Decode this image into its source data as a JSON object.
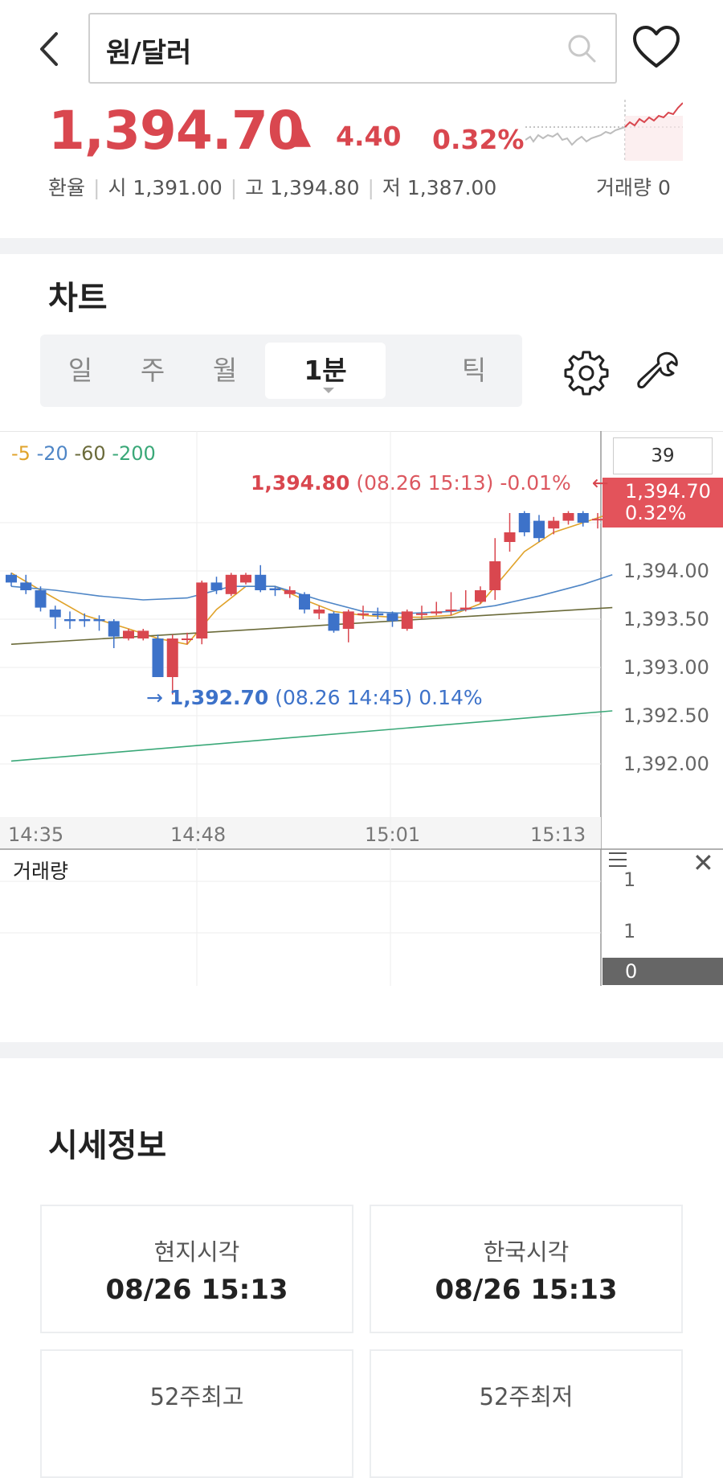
{
  "header": {
    "search_value": "원/달러",
    "price": "1,394.70",
    "arrow": "▲",
    "change": "4.40",
    "change_pct": "0.32%",
    "info": {
      "type_label": "환율",
      "open_label": "시",
      "open": "1,391.00",
      "high_label": "고",
      "high": "1,394.80",
      "low_label": "저",
      "low": "1,387.00"
    },
    "volume_label": "거래량 0"
  },
  "chart_section": {
    "title": "차트",
    "tabs": [
      {
        "label": "일",
        "active": false
      },
      {
        "label": "주",
        "active": false
      },
      {
        "label": "월",
        "active": false
      },
      {
        "label": "1분",
        "active": true
      },
      {
        "label": "틱",
        "active": false
      }
    ],
    "count_value": "39",
    "current_price_tag": "1,394.70",
    "current_pct_tag": "0.32%",
    "legend": [
      "5",
      "20",
      "60",
      "200"
    ],
    "max_annotation": {
      "price": "1,394.80",
      "detail": "(08.26 15:13) -0.01%",
      "arrow": "←"
    },
    "min_annotation": {
      "arrow": "→",
      "price": "1,392.70",
      "detail": "(08.26 14:45) 0.14%"
    },
    "volume_title": "거래량",
    "volume_ticks": [
      "1",
      "1"
    ],
    "volume_tag": "0"
  },
  "market_info": {
    "title": "시세정보",
    "cards": [
      {
        "label": "현지시각",
        "value": "08/26 15:13"
      },
      {
        "label": "한국시각",
        "value": "08/26 15:13"
      },
      {
        "label": "52주최고",
        "value": ""
      },
      {
        "label": "52주최저",
        "value": ""
      }
    ]
  },
  "colors": {
    "up": "#d9474f",
    "down": "#3d72c9",
    "ma5": "#e0a32b",
    "ma20": "#4f86c6",
    "ma60": "#6b6b3a",
    "ma200": "#3aa878"
  },
  "chart_data": {
    "type": "candlestick",
    "x_ticks": [
      "14:35",
      "14:48",
      "15:01",
      "15:13"
    ],
    "y_ticks": [
      "1,394.00",
      "1,393.50",
      "1,393.00",
      "1,392.50",
      "1,392.00"
    ],
    "ylim": [
      1391.7,
      1395.2
    ],
    "candles": [
      {
        "o": 1393.96,
        "c": 1393.88,
        "h": 1393.98,
        "l": 1393.84
      },
      {
        "o": 1393.88,
        "c": 1393.8,
        "h": 1393.96,
        "l": 1393.76
      },
      {
        "o": 1393.8,
        "c": 1393.62,
        "h": 1393.84,
        "l": 1393.58
      },
      {
        "o": 1393.6,
        "c": 1393.52,
        "h": 1393.64,
        "l": 1393.4
      },
      {
        "o": 1393.5,
        "c": 1393.48,
        "h": 1393.58,
        "l": 1393.4
      },
      {
        "o": 1393.5,
        "c": 1393.48,
        "h": 1393.56,
        "l": 1393.42
      },
      {
        "o": 1393.5,
        "c": 1393.48,
        "h": 1393.54,
        "l": 1393.38
      },
      {
        "o": 1393.48,
        "c": 1393.32,
        "h": 1393.5,
        "l": 1393.2
      },
      {
        "o": 1393.3,
        "c": 1393.38,
        "h": 1393.4,
        "l": 1393.28
      },
      {
        "o": 1393.3,
        "c": 1393.38,
        "h": 1393.4,
        "l": 1393.28
      },
      {
        "o": 1393.3,
        "c": 1392.9,
        "h": 1393.34,
        "l": 1392.9
      },
      {
        "o": 1392.9,
        "c": 1393.3,
        "h": 1393.34,
        "l": 1392.72
      },
      {
        "o": 1393.3,
        "c": 1393.3,
        "h": 1393.36,
        "l": 1393.24
      },
      {
        "o": 1393.3,
        "c": 1393.88,
        "h": 1393.9,
        "l": 1393.24
      },
      {
        "o": 1393.88,
        "c": 1393.8,
        "h": 1393.94,
        "l": 1393.76
      },
      {
        "o": 1393.76,
        "c": 1393.96,
        "h": 1393.98,
        "l": 1393.74
      },
      {
        "o": 1393.88,
        "c": 1393.96,
        "h": 1393.98,
        "l": 1393.86
      },
      {
        "o": 1393.96,
        "c": 1393.8,
        "h": 1394.06,
        "l": 1393.78
      },
      {
        "o": 1393.82,
        "c": 1393.8,
        "h": 1393.84,
        "l": 1393.74
      },
      {
        "o": 1393.76,
        "c": 1393.8,
        "h": 1393.84,
        "l": 1393.72
      },
      {
        "o": 1393.76,
        "c": 1393.6,
        "h": 1393.78,
        "l": 1393.56
      },
      {
        "o": 1393.56,
        "c": 1393.6,
        "h": 1393.64,
        "l": 1393.5
      },
      {
        "o": 1393.56,
        "c": 1393.38,
        "h": 1393.58,
        "l": 1393.36
      },
      {
        "o": 1393.4,
        "c": 1393.58,
        "h": 1393.6,
        "l": 1393.26
      },
      {
        "o": 1393.56,
        "c": 1393.56,
        "h": 1393.64,
        "l": 1393.5
      },
      {
        "o": 1393.56,
        "c": 1393.54,
        "h": 1393.62,
        "l": 1393.5
      },
      {
        "o": 1393.56,
        "c": 1393.48,
        "h": 1393.58,
        "l": 1393.42
      },
      {
        "o": 1393.4,
        "c": 1393.58,
        "h": 1393.6,
        "l": 1393.38
      },
      {
        "o": 1393.56,
        "c": 1393.56,
        "h": 1393.64,
        "l": 1393.5
      },
      {
        "o": 1393.56,
        "c": 1393.58,
        "h": 1393.68,
        "l": 1393.54
      },
      {
        "o": 1393.6,
        "c": 1393.6,
        "h": 1393.78,
        "l": 1393.54
      },
      {
        "o": 1393.6,
        "c": 1393.62,
        "h": 1393.8,
        "l": 1393.58
      },
      {
        "o": 1393.68,
        "c": 1393.8,
        "h": 1393.84,
        "l": 1393.66
      },
      {
        "o": 1393.8,
        "c": 1394.1,
        "h": 1394.34,
        "l": 1393.7
      },
      {
        "o": 1394.3,
        "c": 1394.4,
        "h": 1394.6,
        "l": 1394.2
      },
      {
        "o": 1394.6,
        "c": 1394.4,
        "h": 1394.62,
        "l": 1394.36
      },
      {
        "o": 1394.52,
        "c": 1394.34,
        "h": 1394.58,
        "l": 1394.3
      },
      {
        "o": 1394.44,
        "c": 1394.52,
        "h": 1394.56,
        "l": 1394.38
      },
      {
        "o": 1394.52,
        "c": 1394.6,
        "h": 1394.62,
        "l": 1394.48
      },
      {
        "o": 1394.6,
        "c": 1394.5,
        "h": 1394.62,
        "l": 1394.46
      },
      {
        "o": 1394.54,
        "c": 1394.54,
        "h": 1394.6,
        "l": 1394.44
      },
      {
        "o": 1394.6,
        "c": 1394.7,
        "h": 1394.8,
        "l": 1394.56
      }
    ],
    "moving_averages": {
      "ma5": {
        "x": [
          0,
          2,
          5,
          8,
          10,
          12,
          14,
          16,
          18,
          20,
          22,
          24,
          26,
          28,
          30,
          32,
          33,
          35,
          37,
          39,
          41
        ],
        "y": [
          1393.98,
          1393.8,
          1393.54,
          1393.4,
          1393.3,
          1393.24,
          1393.6,
          1393.84,
          1393.84,
          1393.7,
          1393.58,
          1393.54,
          1393.52,
          1393.52,
          1393.54,
          1393.66,
          1393.84,
          1394.2,
          1394.4,
          1394.5,
          1394.6
        ]
      },
      "ma20": {
        "x": [
          0,
          3,
          6,
          9,
          12,
          15,
          18,
          21,
          24,
          27,
          30,
          33,
          36,
          39,
          41
        ],
        "y": [
          1393.84,
          1393.8,
          1393.74,
          1393.7,
          1393.72,
          1393.84,
          1393.84,
          1393.7,
          1393.58,
          1393.56,
          1393.58,
          1393.64,
          1393.74,
          1393.86,
          1393.96
        ]
      },
      "ma60": {
        "x": [
          0,
          41
        ],
        "y": [
          1393.24,
          1393.62
        ]
      },
      "ma200": {
        "x": [
          0,
          41
        ],
        "y": [
          1392.03,
          1392.55
        ]
      }
    }
  }
}
